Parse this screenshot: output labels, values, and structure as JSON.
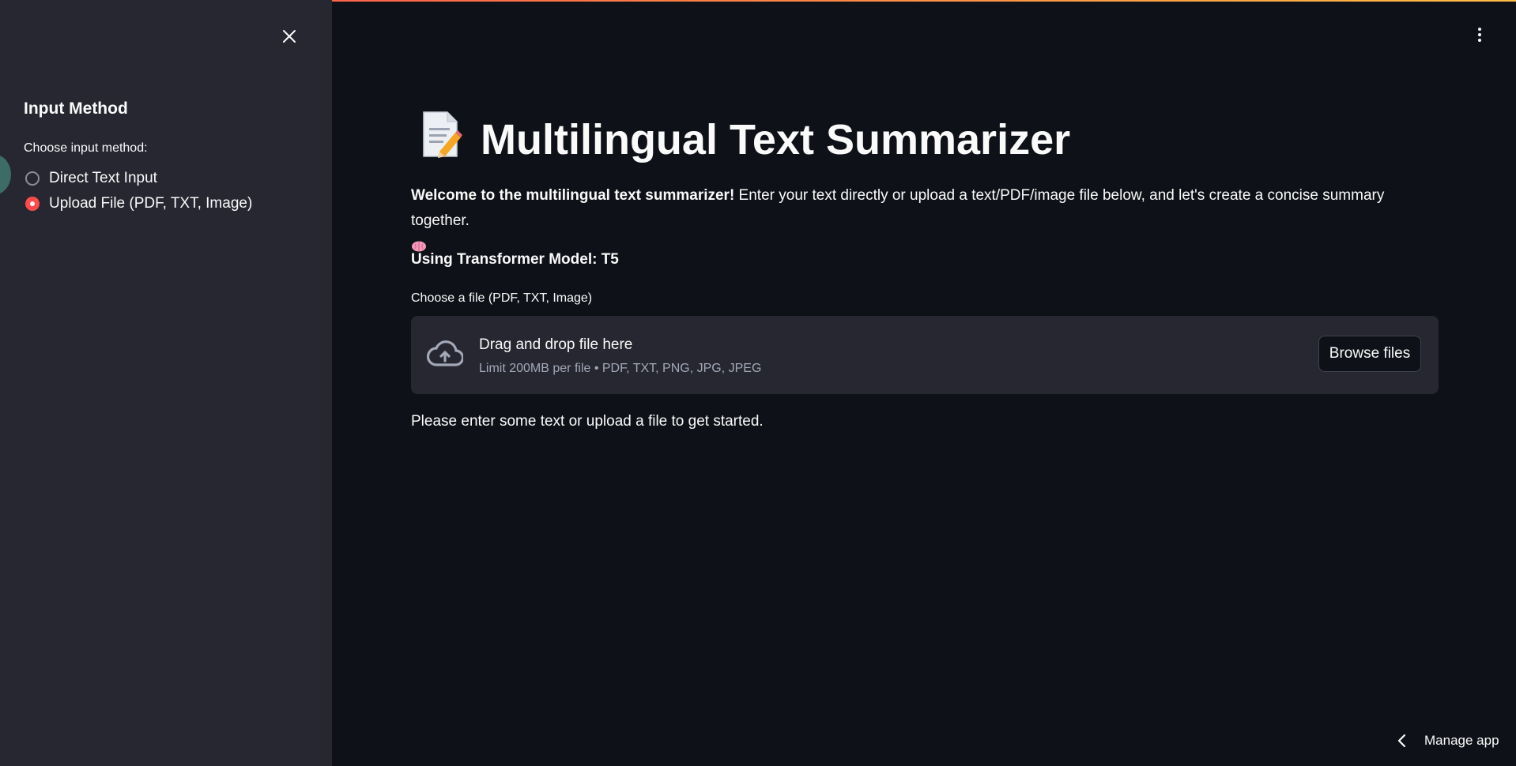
{
  "sidebar": {
    "title": "Input Method",
    "radio_label": "Choose input method:",
    "options": [
      {
        "label": "Direct Text Input",
        "selected": false
      },
      {
        "label": "Upload File (PDF, TXT, Image)",
        "selected": true
      }
    ]
  },
  "main": {
    "title": "Multilingual Text Summarizer",
    "title_icon": "📝",
    "welcome_bold": "Welcome to the multilingual text summarizer!",
    "welcome_text": " Enter your text directly or upload a text/PDF/image file below, and let's create a concise summary together.",
    "model_line": "Using Transformer Model: T5",
    "uploader": {
      "label": "Choose a file (PDF, TXT, Image)",
      "drop_title": "Drag and drop file here",
      "drop_hint": "Limit 200MB per file • PDF, TXT, PNG, JPG, JPEG",
      "browse_label": "Browse files"
    },
    "info_text": "Please enter some text or upload a file to get started."
  },
  "footer": {
    "manage_app_label": "Manage app"
  },
  "colors": {
    "background": "#0e1117",
    "sidebar": "#262730",
    "accent": "#ff4b4b",
    "text": "#fafafa",
    "muted": "#a3a8b8"
  },
  "icons": [
    "close-icon",
    "memo-icon",
    "brain-icon",
    "cloud-upload-icon",
    "kebab-menu-icon",
    "chevron-left-icon"
  ]
}
